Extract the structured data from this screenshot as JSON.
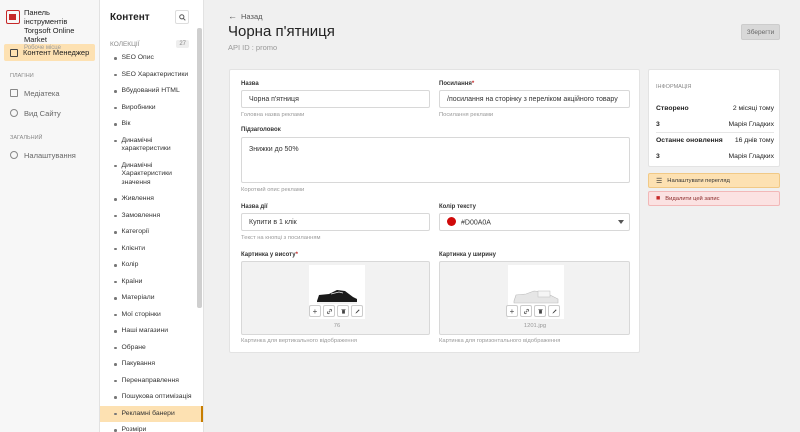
{
  "brand": {
    "line1": "Панель інструментів",
    "line2": "Torgsoft Online Market",
    "line3": "Робоче місце"
  },
  "rail": {
    "active_item": "Контент Менеджер",
    "section_plugins": "ПЛАГІНИ",
    "plugins": [
      {
        "label": "Медіатека",
        "icon": "image-icon"
      },
      {
        "label": "Вид Сайту",
        "icon": "eye-icon"
      }
    ],
    "section_general": "ЗАГАЛЬНИЙ",
    "general": [
      {
        "label": "Налаштування",
        "icon": "gear-icon"
      }
    ]
  },
  "tree": {
    "title": "Контент",
    "collections_label": "КОЛЕКЦІЇ",
    "collections_count": "27",
    "items": [
      "SEO Опис",
      "SEO Характеристики",
      "Вбудований HTML",
      "Виробники",
      "Вік",
      "Динамічні характеристики",
      "Динамічні Характеристики значення",
      "Живлення",
      "Замовлення",
      "Категорії",
      "Клієнти",
      "Колір",
      "Країни",
      "Матеріали",
      "Мої сторінки",
      "Наші магазини",
      "Обране",
      "Пакування",
      "Перенаправлення",
      "Пошукова оптимізація",
      "Рекламні банери",
      "Розміри"
    ],
    "active_index": 20
  },
  "header": {
    "back_label": "Назад",
    "title": "Чорна п'ятниця",
    "api_id": "API ID : promo",
    "save_label": "Зберегти"
  },
  "form": {
    "name": {
      "label": "Назва",
      "value": "Чорна п'ятниця",
      "hint": "Головна назва реклами"
    },
    "link": {
      "label": "Посилання",
      "value": "/посилання на сторінку з переліком акційного товару",
      "hint": "Посилання реклами"
    },
    "subtitle": {
      "label": "Підзаголовок",
      "value": "Знижки до 50%",
      "hint": "Короткий опис реклами"
    },
    "action_name": {
      "label": "Назва дії",
      "value": "Купити в 1 клік",
      "hint": "Текст на кнопці з посиланням"
    },
    "text_color": {
      "label": "Колір тексту",
      "value": "#D00A0A",
      "swatch": "#D00A0A"
    },
    "image_height": {
      "label": "Картинка у висоту",
      "filename": "76",
      "hint": "Картинка для вертикального відображення"
    },
    "image_width": {
      "label": "Картинка у ширину",
      "filename": "1201.jpg",
      "hint": "Картинка для горизонтального відображення"
    }
  },
  "info": {
    "title": "ІНФОРМАЦІЯ",
    "created_label": "Створено",
    "created_value": "2 місяці тому",
    "created_by_id": "3",
    "created_by_name": "Марія Гладких",
    "updated_label": "Останнє оновлення",
    "updated_value": "16 днів тому",
    "updated_by_id": "3",
    "updated_by_name": "Марія Гладких"
  },
  "actions": {
    "review_label": "Налаштувати перегляд",
    "delete_label": "Видалити цей запис"
  }
}
